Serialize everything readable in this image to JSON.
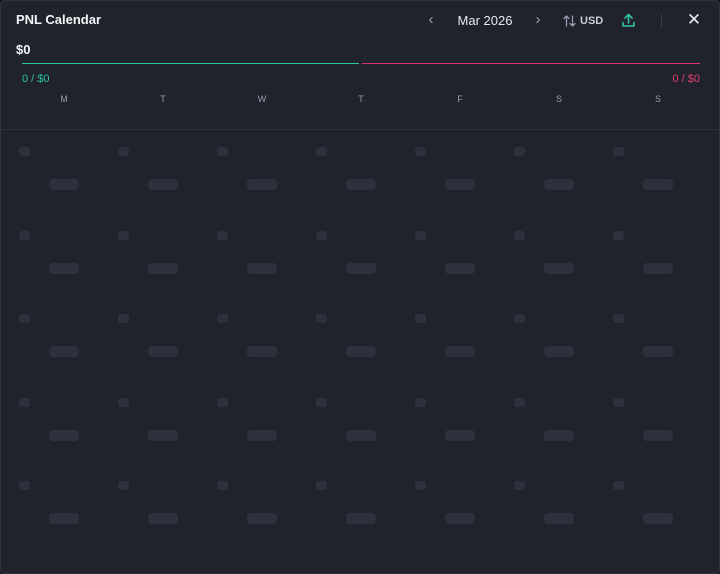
{
  "header": {
    "title": "PNL Calendar",
    "prev_icon": "chevron-left-icon",
    "month": "Mar 2026",
    "next_icon": "chevron-right-icon",
    "currency_icon": "sort-arrows-icon",
    "currency": "USD",
    "export_icon": "upload-icon",
    "close_icon": "close-icon",
    "close_glyph": "✕"
  },
  "summary": {
    "total": "$0",
    "win_stat": "0 / $0",
    "loss_stat": "0 / $0"
  },
  "weekdays": [
    "M",
    "T",
    "W",
    "T",
    "F",
    "S",
    "S"
  ],
  "colors": {
    "background": "#20222c",
    "win": "#2ec4a5",
    "loss": "#e0416f",
    "placeholder": "#2e313d"
  },
  "grid": {
    "rows": 5,
    "cols": 7,
    "state": "loading"
  }
}
